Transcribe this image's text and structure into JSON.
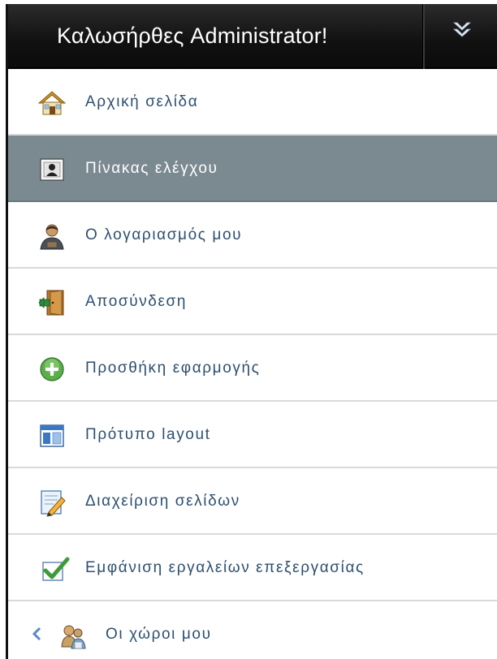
{
  "header": {
    "title": "Καλωσήρθες Administrator!",
    "toggle_icon": "collapse-arrows-icon"
  },
  "menu": {
    "items": [
      {
        "label": "Αρχική σελίδα",
        "icon": "home-icon",
        "active": false
      },
      {
        "label": "Πίνακας ελέγχου",
        "icon": "user-card-icon",
        "active": true
      },
      {
        "label": "Ο λογαριασμός μου",
        "icon": "user-account-icon",
        "active": false
      },
      {
        "label": "Αποσύνδεση",
        "icon": "door-exit-icon",
        "active": false
      },
      {
        "label": "Προσθήκη εφαρμογής",
        "icon": "add-circle-icon",
        "active": false
      },
      {
        "label": "Πρότυπο layout",
        "icon": "layout-icon",
        "active": false
      },
      {
        "label": "Διαχείριση σελίδων",
        "icon": "edit-page-icon",
        "active": false
      },
      {
        "label": "Εμφάνιση εργαλείων επεξεργασίας",
        "icon": "checkmark-icon",
        "active": false
      },
      {
        "label": "Οι χώροι μου",
        "icon": "users-group-icon",
        "active": false
      }
    ]
  },
  "colors": {
    "header_bg": "#111111",
    "active_bg": "#7b8a91",
    "link_text": "#2d4f6f",
    "active_text": "#ffffff",
    "divider": "#d9d9d9"
  }
}
